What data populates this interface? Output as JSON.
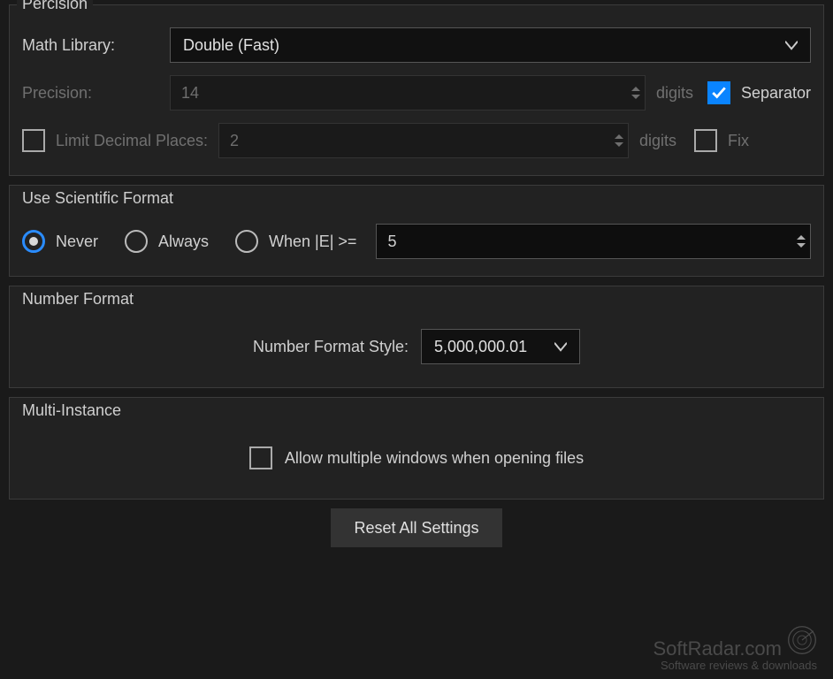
{
  "precision": {
    "group_title": "Percision",
    "math_library_label": "Math Library:",
    "math_library_value": "Double (Fast)",
    "precision_label": "Precision:",
    "precision_value": "14",
    "precision_unit": "digits",
    "separator_label": "Separator",
    "separator_checked": true,
    "limit_decimal_label": "Limit Decimal Places:",
    "limit_decimal_checked": false,
    "limit_decimal_value": "2",
    "limit_decimal_unit": "digits",
    "fix_label": "Fix",
    "fix_checked": false
  },
  "scientific": {
    "group_title": "Use Scientific Format",
    "never_label": "Never",
    "always_label": "Always",
    "when_label": "When |E| >=",
    "selected": "never",
    "threshold_value": "5"
  },
  "number_format": {
    "group_title": "Number Format",
    "style_label": "Number Format Style:",
    "style_value": "5,000,000.01"
  },
  "multi_instance": {
    "group_title": "Multi-Instance",
    "allow_label": "Allow multiple windows when opening files",
    "allow_checked": false
  },
  "footer": {
    "reset_label": "Reset All Settings"
  },
  "watermark": {
    "brand": "SoftRadar.com",
    "tag": "Software reviews & downloads"
  }
}
